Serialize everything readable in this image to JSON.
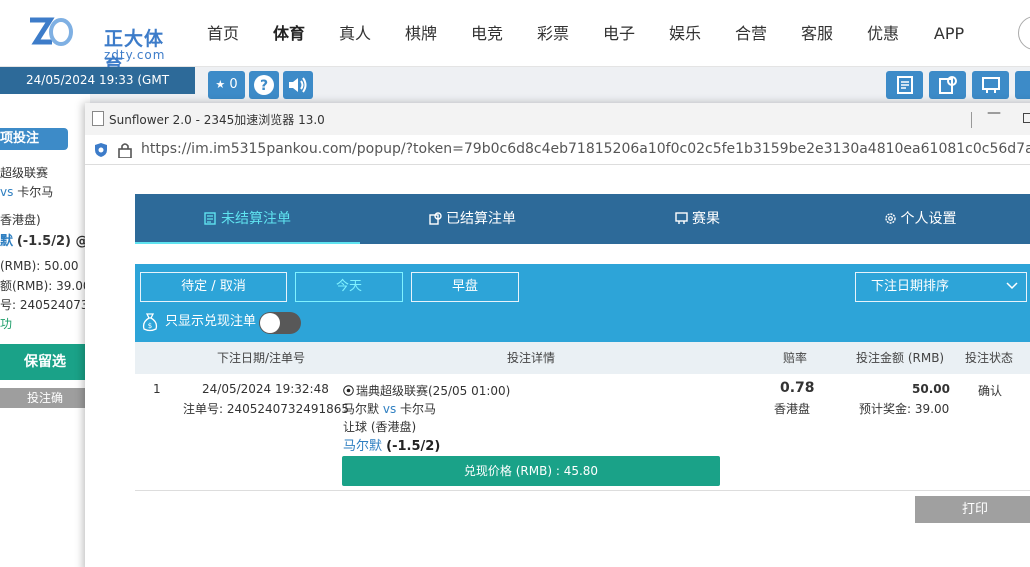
{
  "site": {
    "logo_cn": "正大体育",
    "logo_en": "zdty.com",
    "nav": [
      "首页",
      "体育",
      "真人",
      "棋牌",
      "电竞",
      "彩票",
      "电子",
      "娱乐",
      "合营",
      "客服",
      "优惠",
      "APP"
    ],
    "active_nav": "体育"
  },
  "left_panel": {
    "datetime": "24/05/2024 19:33 (GMT +8)",
    "tab_label": "项投注",
    "league": "超级联赛",
    "vs": "vs",
    "away": "卡尔马",
    "market": "香港盘)",
    "selection_team": "默",
    "selection_line": "(-1.5/2) @",
    "stake": "(RMB): 50.00",
    "payout": "额(RMB): 39.00",
    "bet_no": "号: 2405240732",
    "status": "功",
    "save_label": "保留选",
    "confirm_label": "投注确"
  },
  "toolbar": {
    "count": "0"
  },
  "browser": {
    "title": "Sunflower 2.0 - 2345加速浏览器 13.0",
    "url": "https://im.im5315pankou.com/popup/?token=79b0c6d8c4eb71815206a10f0c02c5fe1b3159be2e3130a4810ea61081c0c56d7a867..."
  },
  "betslip": {
    "tabs": [
      "未结算注单",
      "已结算注单",
      "赛果",
      "个人设置"
    ],
    "active_tab": "未结算注单",
    "filters": [
      "待定 / 取消",
      "今天",
      "早盘"
    ],
    "active_filter": "今天",
    "sort_label": "下注日期排序",
    "cash_only_label": "只显示兑现注单",
    "cash_only_enabled": false,
    "columns": [
      "下注日期/注单号",
      "投注详情",
      "赔率",
      "投注金额 (RMB)",
      "投注状态"
    ],
    "rows": [
      {
        "index": "1",
        "date": "24/05/2024 19:32:48",
        "bet_no": "注单号: 2405240732491865",
        "league": "瑞典超级联赛(25/05 01:00)",
        "home": "马尔默",
        "vs": "vs",
        "away": "卡尔马",
        "market": "让球 (香港盘)",
        "selection": "马尔默",
        "line": "(-1.5/2)",
        "odds": "0.78",
        "odds_type": "香港盘",
        "stake": "50.00",
        "est_payout": "预计奖金: 39.00",
        "status": "确认",
        "cashout": "兑现价格 (RMB) : 45.80"
      }
    ],
    "print_label": "打印"
  },
  "colors": {
    "brand_blue": "#2d6a99",
    "filter_blue": "#2da4d8",
    "accent_cyan": "#5fe3f0",
    "cashout_green": "#1aa288"
  }
}
